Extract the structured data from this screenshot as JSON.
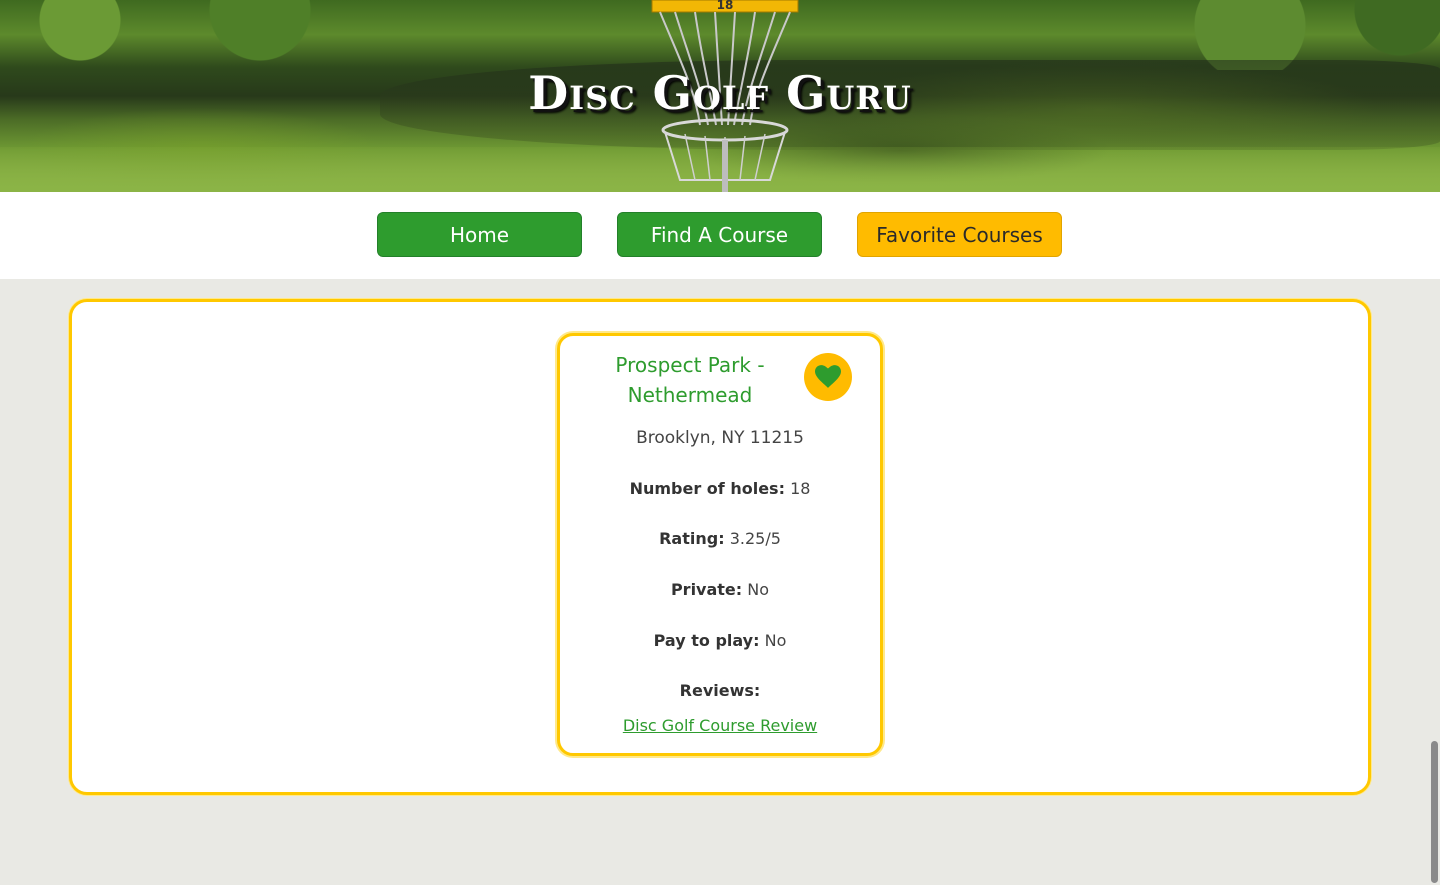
{
  "header": {
    "site_title": "Disc Golf Guru",
    "basket_number": "18"
  },
  "nav": {
    "items": [
      {
        "label": "Home",
        "active": false
      },
      {
        "label": "Find A Course",
        "active": false
      },
      {
        "label": "Favorite Courses",
        "active": true
      }
    ]
  },
  "colors": {
    "accent_green": "#2e9c2e",
    "accent_gold": "#ffbb00",
    "border_gold": "#ffc800"
  },
  "course_card": {
    "name": "Prospect Park - Nethermead",
    "favorite_icon": "heart-icon",
    "address": "Brooklyn, NY 11215",
    "fields": [
      {
        "label": "Number of holes:",
        "value": "18"
      },
      {
        "label": "Rating:",
        "value": "3.25/5"
      },
      {
        "label": "Private:",
        "value": "No"
      },
      {
        "label": "Pay to play:",
        "value": "No"
      },
      {
        "label": "Reviews:",
        "value": ""
      }
    ],
    "review_link": "Disc Golf Course Review"
  }
}
